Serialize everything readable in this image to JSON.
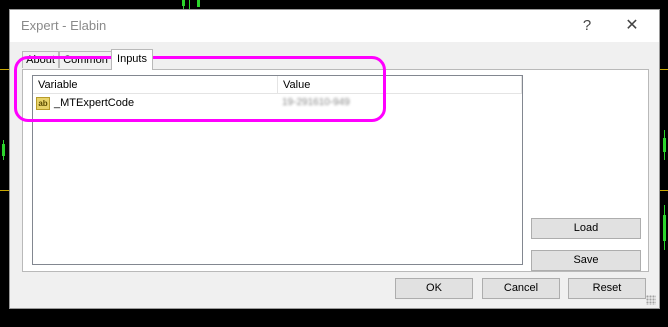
{
  "window": {
    "title": "Expert - Elabin",
    "help_glyph": "?",
    "close_glyph": "✕"
  },
  "tabs": [
    {
      "label": "About"
    },
    {
      "label": "Common"
    },
    {
      "label": "Inputs"
    }
  ],
  "active_tab": "Inputs",
  "inputs_table": {
    "headers": [
      "Variable",
      "Value"
    ],
    "rows": [
      {
        "variable": "_MTExpertCode",
        "value": "19-291610-949",
        "icon": "string-type-icon",
        "icon_text": "ab"
      }
    ]
  },
  "side_buttons": {
    "load": "Load",
    "save": "Save"
  },
  "bottom_buttons": {
    "ok": "OK",
    "cancel": "Cancel",
    "reset": "Reset"
  },
  "colors": {
    "highlight": "#ff00ff",
    "chart_line": "#c9a800",
    "candle": "#2bd62b"
  }
}
